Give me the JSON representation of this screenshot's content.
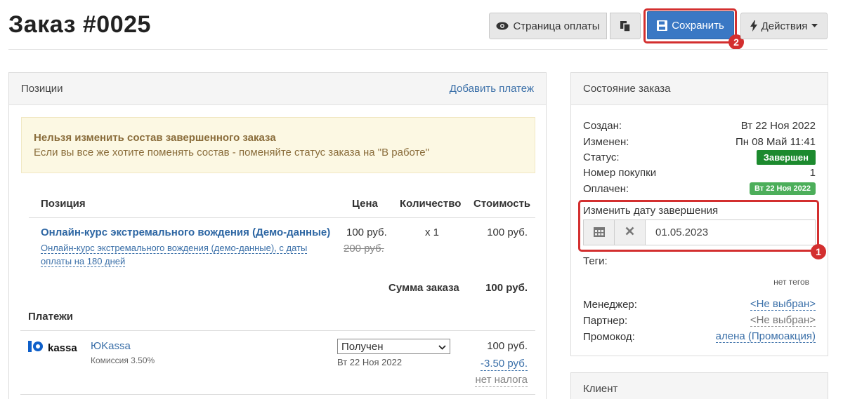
{
  "page": {
    "title": "Заказ #0025"
  },
  "toolbar": {
    "pay_page_label": "Страница оплаты",
    "save_label": "Сохранить",
    "actions_label": "Действия",
    "save_marker": "2"
  },
  "positions": {
    "title": "Позиции",
    "add_payment": "Добавить платеж",
    "alert_title": "Нельзя изменить состав завершенного заказа",
    "alert_text": "Если вы все же хотите поменять состав - поменяйте статус заказа на \"В работе\"",
    "headers": {
      "position": "Позиция",
      "price": "Цена",
      "qty": "Количество",
      "cost": "Стоимость"
    },
    "item": {
      "title": "Онлайн-курс экстремального вождения (Демо-данные)",
      "subtitle": "Онлайн-курс экстремального вождения (демо-данные), с даты оплаты на 180 дней",
      "price": "100 руб.",
      "old_price": "200 руб.",
      "qty": "x 1",
      "cost": "100 руб."
    },
    "sum_label": "Сумма заказа",
    "sum_value": "100 руб."
  },
  "payments": {
    "heading": "Платежи",
    "logo_text": "kassa",
    "name": "ЮKassa",
    "fee_note": "Комиссия 3.50%",
    "status_selected": "Получен",
    "date": "Вт 22 Ноя 2022",
    "amount": "100 руб.",
    "fee_amount": "-3.50 руб.",
    "tax": "нет налога"
  },
  "order_state": {
    "title": "Состояние заказа",
    "created_label": "Создан:",
    "created_value": "Вт 22 Ноя 2022",
    "changed_label": "Изменен:",
    "changed_value": "Пн 08 Май 11:41",
    "status_label": "Статус:",
    "status_value": "Завершен",
    "purchase_label": "Номер покупки",
    "purchase_value": "1",
    "paid_label": "Оплачен:",
    "paid_value": "Вт 22 Ноя 2022",
    "change_date_label": "Изменить дату завершения",
    "completion_date": "01.05.2023",
    "date_marker": "1",
    "tags_label": "Теги:",
    "tags_value": "нет тегов",
    "manager_label": "Менеджер:",
    "manager_value": "<Не выбран>",
    "partner_label": "Партнер:",
    "partner_value": "<Не выбран>",
    "promo_label": "Промокод:",
    "promo_value": "алена (Промоакция)"
  },
  "client": {
    "title": "Клиент"
  },
  "colors": {
    "primary": "#3a78c4",
    "link": "#3a6fa8",
    "success_dark": "#1c8a2e",
    "success": "#4cae5a",
    "highlight": "#d32f2f",
    "alert_bg": "#fcf8e3"
  }
}
